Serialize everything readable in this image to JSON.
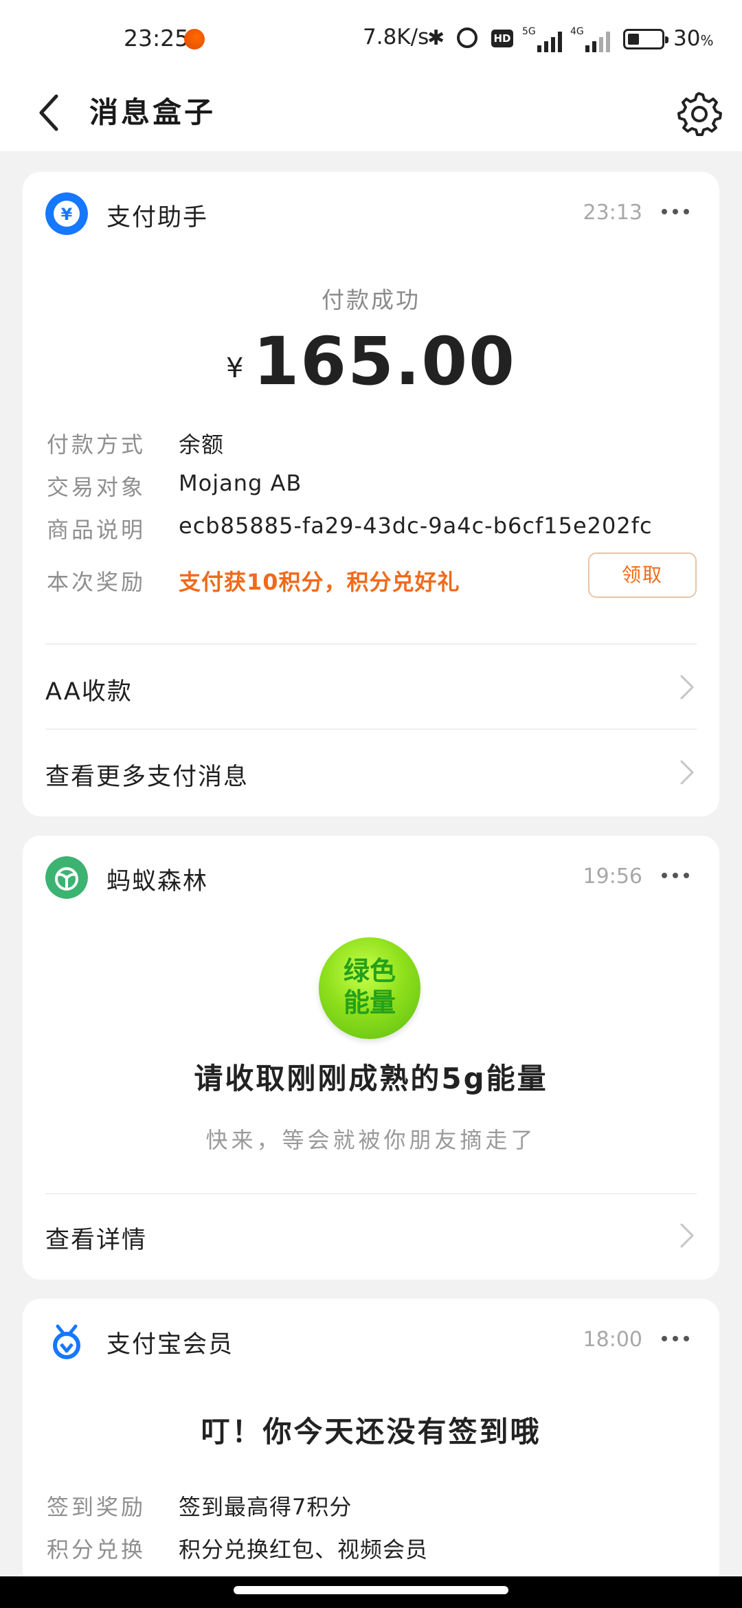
{
  "status_bar": {
    "time": "23:25",
    "net_speed": "7.8K/s",
    "hd_badge": "HD",
    "signal1_label": "5G",
    "signal2_label": "4G",
    "battery_percent": "30",
    "battery_unit": "%"
  },
  "header": {
    "title": "消息盒子"
  },
  "payment_card": {
    "app_name": "支付助手",
    "time": "23:13",
    "status": "付款成功",
    "currency": "¥",
    "amount": "165.00",
    "details": [
      {
        "key": "付款方式",
        "value": "余额"
      },
      {
        "key": "交易对象",
        "value": "Mojang AB"
      },
      {
        "key": "商品说明",
        "value": "ecb85885-fa29-43dc-9a4c-b6cf15e202fc"
      },
      {
        "key": "本次奖励",
        "value": "支付获10积分，积分兑好礼"
      }
    ],
    "claim_label": "领取",
    "links": [
      "AA收款",
      "查看更多支付消息"
    ]
  },
  "forest_card": {
    "app_name": "蚂蚁森林",
    "time": "19:56",
    "badge_line1": "绿色",
    "badge_line2": "能量",
    "title": "请收取刚刚成熟的5g能量",
    "subtitle": "快来，等会就被你朋友摘走了",
    "link": "查看详情"
  },
  "member_card": {
    "app_name": "支付宝会员",
    "time": "18:00",
    "title": "叮！你今天还没有签到哦",
    "details": [
      {
        "key": "签到奖励",
        "value": "签到最高得7积分"
      },
      {
        "key": "积分兑换",
        "value": "积分兑换红包、视频会员"
      }
    ]
  },
  "colors": {
    "accent_blue": "#1677ff",
    "reward_orange": "#f06a1a",
    "forest_green": "#3cb371"
  }
}
